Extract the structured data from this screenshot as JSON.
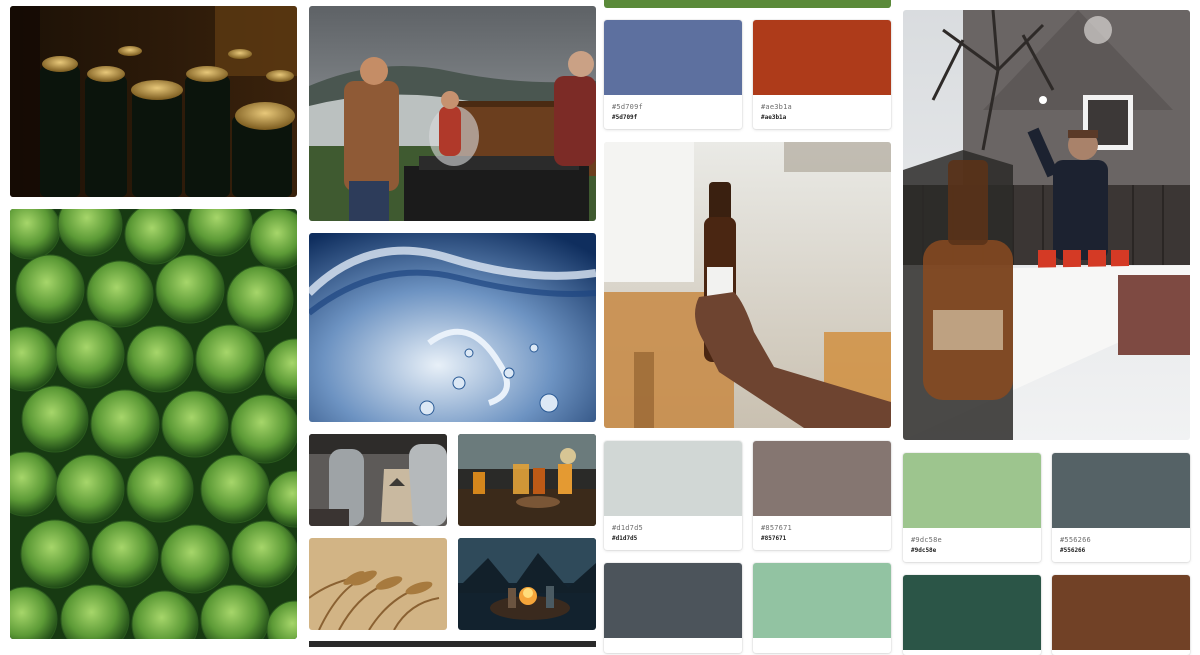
{
  "palette": {
    "swatches": [
      {
        "id": "5d709f",
        "color": "#5d709f",
        "label": "#5d709f",
        "code": "#5d709f"
      },
      {
        "id": "ae3b1a",
        "color": "#ae3b1a",
        "label": "#ae3b1a",
        "code": "#ae3b1a"
      },
      {
        "id": "d1d7d5",
        "color": "#d1d7d5",
        "label": "#d1d7d5",
        "code": "#d1d7d5"
      },
      {
        "id": "857671",
        "color": "#857671",
        "label": "#857671",
        "code": "#857671"
      },
      {
        "id": "9dc58e",
        "color": "#9dc58e",
        "label": "#9dc58e",
        "code": "#9dc58e"
      },
      {
        "id": "556266",
        "color": "#556266",
        "label": "#556266",
        "code": "#556266"
      },
      {
        "id": "4c545b",
        "color": "#4c545b"
      },
      {
        "id": "92c3a2",
        "color": "#92c3a2"
      },
      {
        "id": "2b5547",
        "color": "#2b5547"
      },
      {
        "id": "714126",
        "color": "#714126"
      }
    ]
  },
  "photos": [
    {
      "name": "beer-bottles-photo"
    },
    {
      "name": "grilling-outdoors-photo"
    },
    {
      "name": "hops-photo"
    },
    {
      "name": "water-splash-photo"
    },
    {
      "name": "brewery-tanks-photo"
    },
    {
      "name": "beer-glasses-table-photo"
    },
    {
      "name": "wheat-field-photo"
    },
    {
      "name": "campfire-night-photo"
    },
    {
      "name": "hand-holding-bottle-photo"
    },
    {
      "name": "beer-pong-snow-photo"
    }
  ]
}
